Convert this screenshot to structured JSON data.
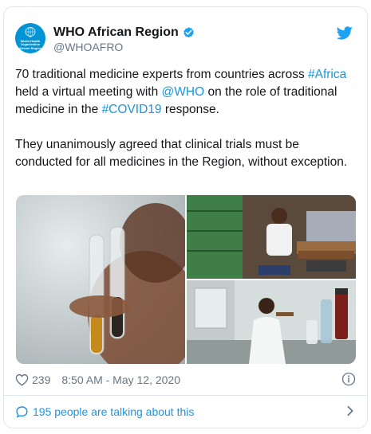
{
  "account": {
    "display_name": "WHO African Region",
    "handle": "@WHOAFRO",
    "avatar_text": "World Health Organization African Region"
  },
  "tweet": {
    "segments": [
      {
        "text": "70 traditional medicine experts from countries across ",
        "link": false
      },
      {
        "text": "#Africa",
        "link": true
      },
      {
        "text": " held a virtual meeting with ",
        "link": false
      },
      {
        "text": "@WHO",
        "link": true
      },
      {
        "text": " on the role of traditional medicine in the ",
        "link": false
      },
      {
        "text": "#COVID19",
        "link": true
      },
      {
        "text": " response.\n\nThey unanimously agreed that clinical trials must be conducted for all medicines in the Region, without exception.",
        "link": false
      }
    ]
  },
  "footer": {
    "likes": "239",
    "timestamp": "8:50 AM - May 12, 2020"
  },
  "conversation": {
    "label": "195 people are talking about this"
  },
  "colors": {
    "link": "#1b95e0",
    "twitter_blue": "#1da1f2",
    "who_blue": "#0093d5",
    "secondary_text": "#657786"
  },
  "icons": [
    "verified-badge-icon",
    "twitter-logo-icon",
    "heart-icon",
    "info-icon",
    "comment-bubble-icon",
    "chevron-right-icon"
  ]
}
